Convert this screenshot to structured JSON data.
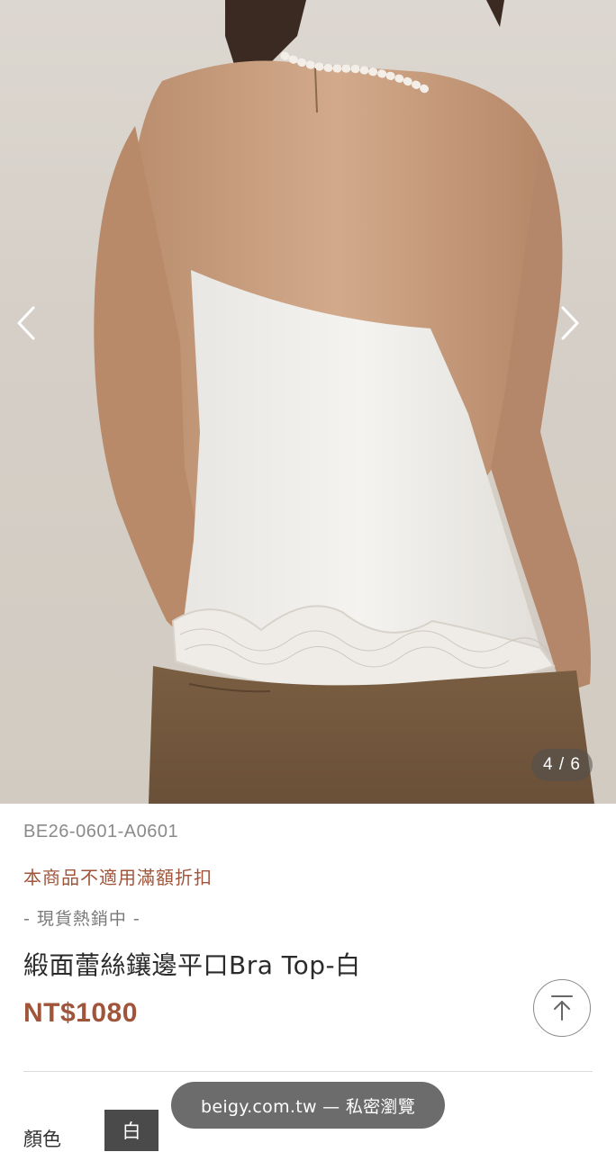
{
  "gallery": {
    "image_alt": "",
    "counter": "4 / 6",
    "prev_icon": "chevron-left-icon",
    "next_icon": "chevron-right-icon"
  },
  "product": {
    "sku": "BE26-0601-A0601",
    "discount_notice": "本商品不適用滿額折扣",
    "stock_status": "- 現貨熱銷中 -",
    "name": "緞面蕾絲鑲邊平口Bra Top-白",
    "price": "NT$1080"
  },
  "options": {
    "color_label": "顏色",
    "selected_color": "白"
  },
  "back_to_top_icon": "arrow-up-icon",
  "browser_toast": "beigy.com.tw — 私密瀏覽",
  "colors": {
    "accent": "#a0553a",
    "swatch_bg": "#4a4a4a",
    "background": "#ffffff"
  }
}
